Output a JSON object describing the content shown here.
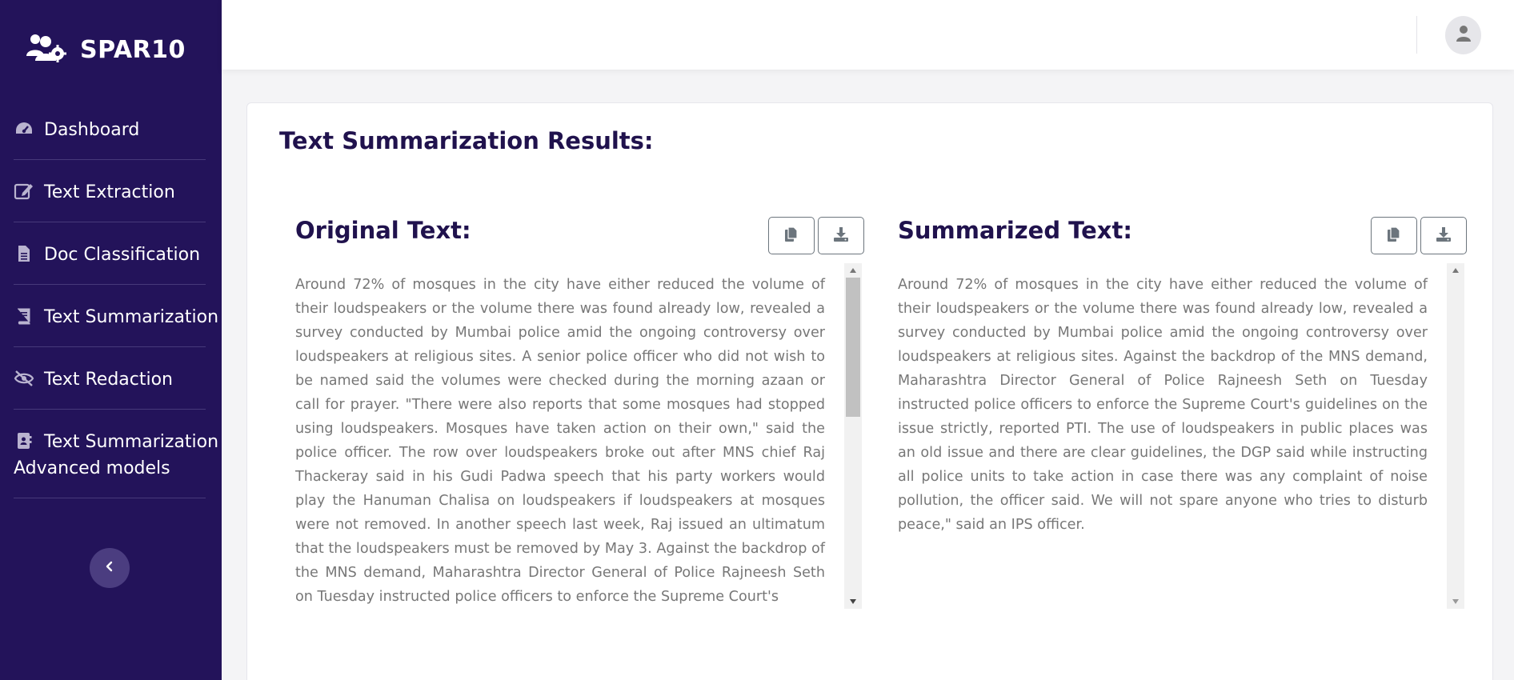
{
  "brand": {
    "name": "SPAR10",
    "icon": "users-gear-icon"
  },
  "sidebar": {
    "items": [
      {
        "label": "Dashboard",
        "icon": "gauge-icon"
      },
      {
        "label": "Text Extraction",
        "icon": "edit-icon"
      },
      {
        "label": "Doc Classification",
        "icon": "file-icon"
      },
      {
        "label": "Text Summarization",
        "icon": "book-icon"
      },
      {
        "label": "Text Redaction",
        "icon": "eye-slash-icon"
      },
      {
        "label": "Text Summarization",
        "label_line2": "Advanced models",
        "icon": "address-book-icon"
      }
    ],
    "collapse_icon": "chevron-left-icon"
  },
  "header": {
    "avatar_icon": "user-icon"
  },
  "main": {
    "title": "Text Summarization Results:",
    "original": {
      "title": "Original Text:",
      "copy_icon": "copy-icon",
      "download_icon": "download-icon",
      "text": "Around 72% of mosques in the city have either reduced the volume of their loudspeakers or the volume there was found already low, revealed a survey conducted by Mumbai police amid the ongoing controversy over loudspeakers at religious sites. A senior police officer who did not wish to be named said the volumes were checked during the morning azaan or call for prayer. \"There were also reports that some mosques had stopped using loudspeakers. Mosques have taken action on their own,\" said the police officer. The row over loudspeakers broke out after MNS chief Raj Thackeray said in his Gudi Padwa speech that his party workers would play the Hanuman Chalisa on loudspeakers if loudspeakers at mosques were not removed. In another speech last week, Raj issued an ultimatum that the loudspeakers must be removed by May 3. Against the backdrop of the MNS demand, Maharashtra Director General of Police Rajneesh Seth on Tuesday instructed police officers to enforce the Supreme Court's"
    },
    "summarized": {
      "title": "Summarized Text:",
      "copy_icon": "copy-icon",
      "download_icon": "download-icon",
      "text": "Around 72% of mosques in the city have either reduced the volume of their loudspeakers or the volume there was found already low, revealed a survey conducted by Mumbai police amid the ongoing controversy over loudspeakers at religious sites. Against the backdrop of the MNS demand, Maharashtra Director General of Police Rajneesh Seth on Tuesday instructed police officers to enforce the Supreme Court's guidelines on the issue strictly, reported PTI. The use of loudspeakers in public places was an old issue and there are clear guidelines, the DGP said while instructing all police units to take action in case there was any complaint of noise pollution, the officer said. We will not spare anyone who tries to disturb peace,\" said an IPS officer."
    }
  },
  "colors": {
    "sidebar_bg": "#23135a",
    "title_color": "#20124d",
    "body_text": "#777777"
  }
}
